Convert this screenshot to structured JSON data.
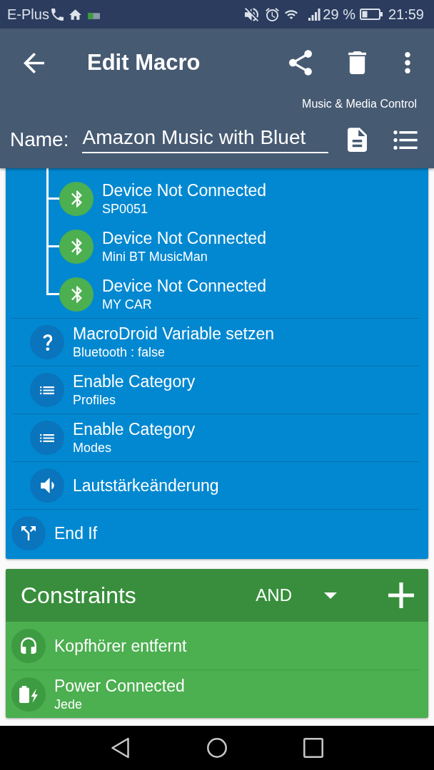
{
  "status_bar": {
    "carrier": "E-Plus",
    "battery_percent": "29 %",
    "time": "21:59"
  },
  "app_bar": {
    "title": "Edit Macro",
    "category": "Music & Media Control",
    "name_label": "Name:",
    "name_value": "Amazon Music with Bluet"
  },
  "actions": [
    {
      "kind": "if_block",
      "children": [
        {
          "kind": "condition_branch",
          "children": [
            {
              "kind": "bluetooth",
              "title": "Device Not Connected",
              "subtitle": "SP0051"
            },
            {
              "kind": "bluetooth",
              "title": "Device Not Connected",
              "subtitle": "Mini BT MusicMan"
            },
            {
              "kind": "bluetooth",
              "title": "Device Not Connected",
              "subtitle": "MY CAR"
            }
          ]
        },
        {
          "kind": "variable",
          "title": "MacroDroid Variable setzen",
          "subtitle": "Bluetooth : false"
        },
        {
          "kind": "category",
          "title": "Enable Category",
          "subtitle": "Profiles"
        },
        {
          "kind": "category",
          "title": "Enable Category",
          "subtitle": "Modes"
        },
        {
          "kind": "volume",
          "title": "Lautstärkeänderung"
        }
      ]
    },
    {
      "kind": "end_if",
      "title": "End If"
    }
  ],
  "constraints": {
    "title": "Constraints",
    "logic": "AND",
    "items": [
      {
        "kind": "headphones",
        "title": "Kopfhörer entfernt"
      },
      {
        "kind": "power",
        "title": "Power Connected",
        "subtitle": "Jede"
      }
    ]
  }
}
